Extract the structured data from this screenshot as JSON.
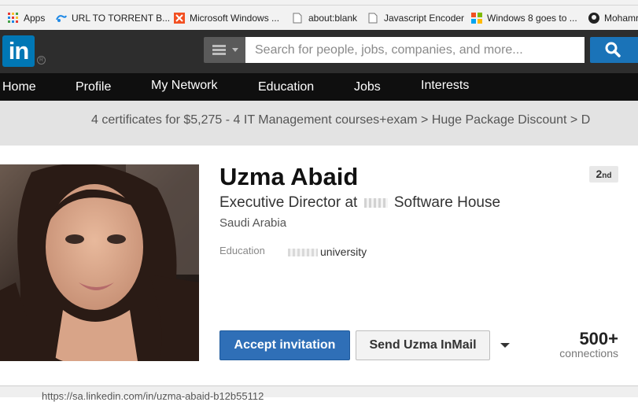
{
  "bookmarks": [
    {
      "label": "Apps",
      "icon": "apps-grid-icon"
    },
    {
      "label": "URL TO TORRENT B...",
      "icon": "torrent-icon"
    },
    {
      "label": "Microsoft Windows ...",
      "icon": "windows-logo-icon"
    },
    {
      "label": "about:blank",
      "icon": "page-icon"
    },
    {
      "label": "Javascript Encoder",
      "icon": "page-icon"
    },
    {
      "label": "Windows 8 goes to ...",
      "icon": "windows-logo-icon"
    },
    {
      "label": "Mohamr",
      "icon": "github-icon"
    }
  ],
  "header": {
    "logo_text": "in",
    "logo_mark": "R",
    "search_placeholder": "Search for people, jobs, companies, and more...",
    "colors": {
      "brand": "#0077b5",
      "header_bg": "#2d2d2d",
      "nav_bg": "#0f0f0f",
      "accent_button": "#2f6fb7"
    }
  },
  "nav": {
    "items": [
      "Home",
      "Profile",
      "My Network",
      "Education",
      "Jobs",
      "Interests"
    ]
  },
  "ad": {
    "text": "4 certificates for $5,275 - 4 IT Management courses+exam > Huge Package Discount > D"
  },
  "profile": {
    "name": "Uzma Abaid",
    "degree": "2",
    "degree_suffix": "nd",
    "headline_prefix": "Executive Director at",
    "headline_suffix": "Software House",
    "location": "Saudi Arabia",
    "education_label": "Education",
    "education_value": "university",
    "accept_label": "Accept invitation",
    "inmail_label": "Send Uzma InMail",
    "connections_count": "500+",
    "connections_label": "connections"
  },
  "status": {
    "text": "https://sa.linkedin.com/in/uzma-abaid-b12b55112"
  }
}
